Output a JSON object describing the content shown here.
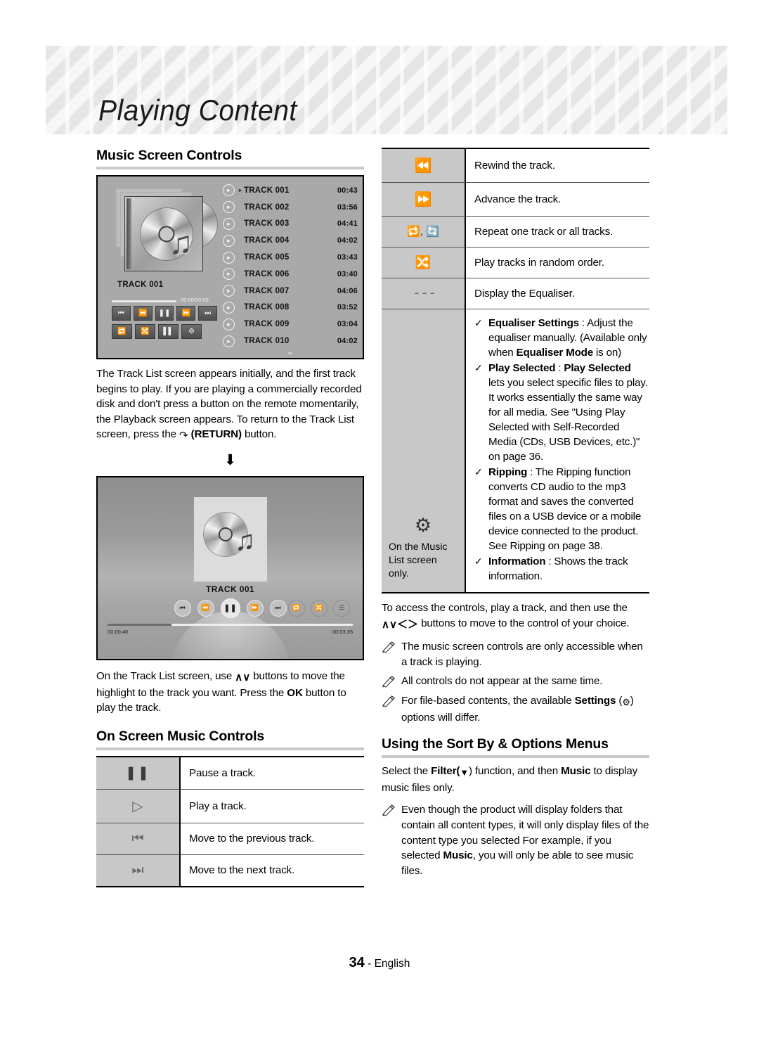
{
  "header": {
    "chapter_title": "Playing Content"
  },
  "left": {
    "section_title": "Music Screen Controls",
    "tracklist_shot": {
      "art_label": "TRACK 001",
      "time_readout": "00:00/00:00",
      "transport_row1": [
        "prev-track-icon",
        "rewind-icon",
        "pause-icon",
        "fast-forward-icon",
        "next-track-icon"
      ],
      "transport_row2": [
        "repeat-icon",
        "shuffle-icon",
        "equaliser-icon",
        "settings-gear-icon"
      ],
      "tracks": [
        {
          "name": "TRACK 001",
          "time": "00:43",
          "selected": true
        },
        {
          "name": "TRACK 002",
          "time": "03:56",
          "selected": false
        },
        {
          "name": "TRACK 003",
          "time": "04:41",
          "selected": false
        },
        {
          "name": "TRACK 004",
          "time": "04:02",
          "selected": false
        },
        {
          "name": "TRACK 005",
          "time": "03:43",
          "selected": false
        },
        {
          "name": "TRACK 006",
          "time": "03:40",
          "selected": false
        },
        {
          "name": "TRACK 007",
          "time": "04:06",
          "selected": false
        },
        {
          "name": "TRACK 008",
          "time": "03:52",
          "selected": false
        },
        {
          "name": "TRACK 009",
          "time": "03:04",
          "selected": false
        },
        {
          "name": "TRACK 010",
          "time": "04:02",
          "selected": false
        }
      ]
    },
    "paragraph_1_a": "The Track List screen appears initially, and the first track begins to play. If you are playing a commercially recorded disk and don't press a button on the remote momentarily, the Playback screen appears. To return to the Track List screen, press the ",
    "paragraph_1_return": "(RETURN)",
    "paragraph_1_b": " button.",
    "player_shot": {
      "track_label": "TRACK 001",
      "elapsed": "00:00:40",
      "total": "00:03:35"
    },
    "paragraph_2_a": "On the Track List screen, use ",
    "paragraph_2_b": " buttons to move the highlight to the track you want. Press the ",
    "paragraph_2_ok": "OK",
    "paragraph_2_c": " button to play the track.",
    "onscreen_section_title": "On Screen Music Controls",
    "onscreen_rows": [
      {
        "icon": "pause-icon",
        "glyph": "❙❙",
        "desc": "Pause a track."
      },
      {
        "icon": "play-icon",
        "glyph": "▷",
        "desc": "Play a track."
      },
      {
        "icon": "previous-track-icon",
        "glyph": "",
        "desc": "Move to the previous track."
      },
      {
        "icon": "next-track-icon",
        "glyph": "",
        "desc": "Move to the next track."
      }
    ]
  },
  "right": {
    "control_rows": [
      {
        "icon": "rewind-icon",
        "desc": "Rewind the track."
      },
      {
        "icon": "advance-icon",
        "desc": "Advance the track."
      },
      {
        "icon": "repeat-one-and-repeat-all-icon",
        "desc": "Repeat one track or all tracks."
      },
      {
        "icon": "shuffle-icon",
        "desc": "Play tracks in random order."
      },
      {
        "icon": "equaliser-icon",
        "desc": "Display the Equaliser."
      }
    ],
    "settings_row": {
      "icon": "settings-gear-icon",
      "icon_caption": "On the Music List screen only.",
      "items": [
        {
          "term": "Equaliser Settings",
          "text_a": " : Adjust the equaliser manually. (Available only when ",
          "bold_mid": "Equaliser Mode",
          "text_b": " is on)"
        },
        {
          "term": "Play Selected",
          "text_a": " : ",
          "bold_mid": "Play Selected",
          "text_b": " lets you select specific files to play. It works essentially the same way for all media. See \"Using Play Selected with Self-Recorded Media (CDs, USB Devices, etc.)\" on page 36."
        },
        {
          "term": "Ripping",
          "text_a": " : The Ripping function converts CD audio to the mp3 format and saves the converted files on a USB device or a mobile device connected to the product. See Ripping on page 38.",
          "bold_mid": "",
          "text_b": ""
        },
        {
          "term": "Information",
          "text_a": " : Shows the track information.",
          "bold_mid": "",
          "text_b": ""
        }
      ]
    },
    "access_paragraph_a": "To access the controls, play a track, and then use the ",
    "access_paragraph_b": " buttons to move to the control of your choice.",
    "notes": [
      {
        "text": "The music screen controls are only accessible when a track is playing."
      },
      {
        "text": "All controls do not appear at the same time."
      }
    ],
    "note_settings_a": "For file-based contents, the available ",
    "note_settings_bold": "Settings",
    "note_settings_b": " (",
    "note_settings_c": ") options will differ.",
    "sort_section_title": "Using the Sort By & Options Menus",
    "sort_paragraph_a": "Select the ",
    "sort_paragraph_filter": "Filter(",
    "sort_paragraph_b": ") function, and then ",
    "sort_paragraph_music": "Music",
    "sort_paragraph_c": " to display music files only.",
    "sort_note_a": "Even though the product will display folders that contain all content types, it will only display files of the content type you selected For example, if you selected ",
    "sort_note_bold": "Music",
    "sort_note_b": ", you will only be able to see music files."
  },
  "footer": {
    "page_number": "34",
    "language": "- English"
  }
}
